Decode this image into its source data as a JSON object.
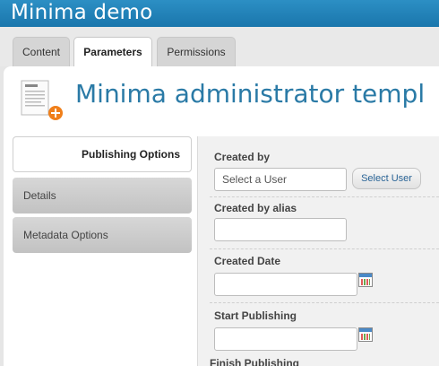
{
  "app": {
    "title": "Minima demo"
  },
  "tabs": [
    {
      "label": "Content"
    },
    {
      "label": "Parameters"
    },
    {
      "label": "Permissions"
    }
  ],
  "page": {
    "title": "Minima administrator templ"
  },
  "accordion": [
    {
      "label": "Publishing Options"
    },
    {
      "label": "Details"
    },
    {
      "label": "Metadata Options"
    }
  ],
  "form": {
    "created_by": {
      "label": "Created by",
      "value": "Select a User",
      "button": "Select User"
    },
    "created_by_alias": {
      "label": "Created by alias",
      "value": ""
    },
    "created_date": {
      "label": "Created Date",
      "value": ""
    },
    "start_publishing": {
      "label": "Start Publishing",
      "value": ""
    },
    "finish_publishing": {
      "label": "Finish Publishing"
    }
  },
  "icons": {
    "page": "article-add-icon",
    "calendar": "calendar-icon"
  },
  "colors": {
    "accent": "#1a76ac",
    "title": "#2a7aa6"
  }
}
